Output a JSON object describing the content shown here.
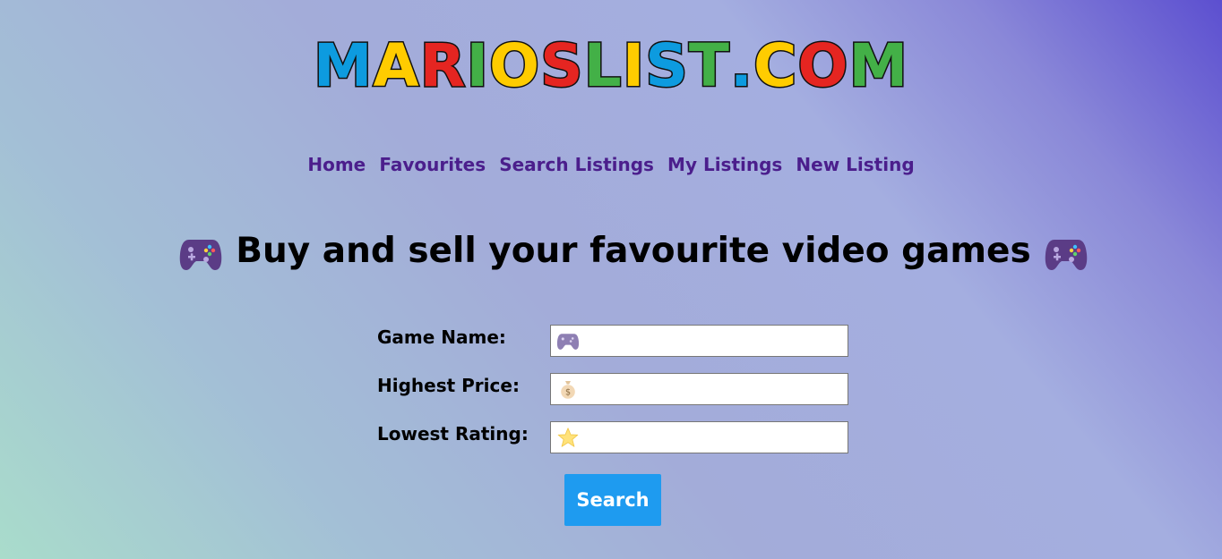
{
  "logo": {
    "letters": [
      {
        "char": "M",
        "color": "#0d9bdf"
      },
      {
        "char": "A",
        "color": "#ffcc00"
      },
      {
        "char": "R",
        "color": "#e52521"
      },
      {
        "char": "I",
        "color": "#43b047"
      },
      {
        "char": "O",
        "color": "#ffcc00"
      },
      {
        "char": "S",
        "color": "#e52521"
      },
      {
        "char": "L",
        "color": "#43b047"
      },
      {
        "char": "I",
        "color": "#ffcc00"
      },
      {
        "char": "S",
        "color": "#0d9bdf"
      },
      {
        "char": "T",
        "color": "#43b047"
      },
      {
        "char": ".",
        "color": "#0d9bdf"
      },
      {
        "char": "C",
        "color": "#ffcc00"
      },
      {
        "char": "O",
        "color": "#e52521"
      },
      {
        "char": "M",
        "color": "#43b047"
      }
    ]
  },
  "nav": {
    "items": [
      {
        "label": "Home",
        "name": "nav-link-home"
      },
      {
        "label": "Favourites",
        "name": "nav-link-favourites"
      },
      {
        "label": "Search Listings",
        "name": "nav-link-search-listings"
      },
      {
        "label": "My Listings",
        "name": "nav-link-my-listings"
      },
      {
        "label": "New Listing",
        "name": "nav-link-new-listing"
      }
    ],
    "color": "#4b1e8c"
  },
  "headline": {
    "text": "Buy and sell your favourite video games",
    "icon": "game-controller-icon"
  },
  "form": {
    "game_name": {
      "label": "Game Name:",
      "icon": "game-controller-icon",
      "value": "",
      "placeholder": ""
    },
    "highest_price": {
      "label": "Highest Price:",
      "icon": "money-bag-icon",
      "value": "",
      "placeholder": ""
    },
    "lowest_rating": {
      "label": "Lowest Rating:",
      "icon": "star-icon",
      "value": "",
      "placeholder": ""
    },
    "search_label": "Search",
    "button_color": "#1e9bf0"
  }
}
